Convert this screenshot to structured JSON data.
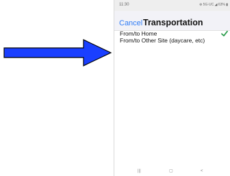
{
  "status_bar": {
    "time": "11:30",
    "right": "⊕ 5G·UC ◢ 63% ▮"
  },
  "header": {
    "cancel_label": "Cancel",
    "title": "Transportation"
  },
  "options": [
    {
      "label": "From/to Home",
      "selected": true
    },
    {
      "label": "From/to Other Site (daycare, etc)",
      "selected": false
    }
  ],
  "nav": {
    "recents": "|||",
    "home": "▢",
    "back": "<"
  },
  "colors": {
    "accent": "#2f7cf6",
    "check": "#2e9e4f",
    "arrow_fill": "#1a3fff"
  },
  "icons": [
    "right-arrow-icon",
    "check-icon"
  ]
}
